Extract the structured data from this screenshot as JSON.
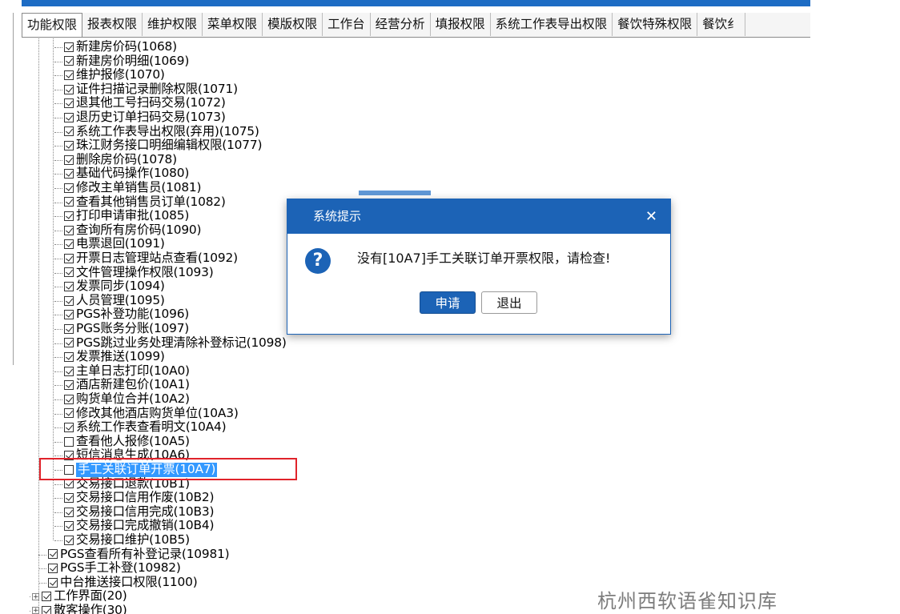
{
  "tabs": [
    {
      "label": "功能权限",
      "active": true
    },
    {
      "label": "报表权限"
    },
    {
      "label": "维护权限"
    },
    {
      "label": "菜单权限"
    },
    {
      "label": "模版权限"
    },
    {
      "label": "工作台"
    },
    {
      "label": "经营分析"
    },
    {
      "label": "填报权限"
    },
    {
      "label": "系统工作表导出权限"
    },
    {
      "label": "餐饮特殊权限"
    },
    {
      "label": "餐饮纟"
    }
  ],
  "tree": {
    "children": [
      {
        "label": "新建房价码(1068)",
        "checked": true
      },
      {
        "label": "新建房价明细(1069)",
        "checked": true
      },
      {
        "label": "维护报修(1070)",
        "checked": true
      },
      {
        "label": "证件扫描记录删除权限(1071)",
        "checked": true
      },
      {
        "label": "退其他工号扫码交易(1072)",
        "checked": true
      },
      {
        "label": "退历史订单扫码交易(1073)",
        "checked": true
      },
      {
        "label": "系统工作表导出权限(弃用)(1075)",
        "checked": true
      },
      {
        "label": "珠江财务接口明细编辑权限(1077)",
        "checked": true
      },
      {
        "label": "删除房价码(1078)",
        "checked": true
      },
      {
        "label": "基础代码操作(1080)",
        "checked": true
      },
      {
        "label": "修改主单销售员(1081)",
        "checked": true
      },
      {
        "label": "查看其他销售员订单(1082)",
        "checked": true
      },
      {
        "label": "打印申请审批(1085)",
        "checked": true
      },
      {
        "label": "查询所有房价码(1090)",
        "checked": true
      },
      {
        "label": "电票退回(1091)",
        "checked": true
      },
      {
        "label": "开票日志管理站点查看(1092)",
        "checked": true
      },
      {
        "label": "文件管理操作权限(1093)",
        "checked": true
      },
      {
        "label": "发票同步(1094)",
        "checked": true
      },
      {
        "label": "人员管理(1095)",
        "checked": true
      },
      {
        "label": "PGS补登功能(1096)",
        "checked": true
      },
      {
        "label": "PGS账务分账(1097)",
        "checked": true
      },
      {
        "label": "PGS跳过业务处理清除补登标记(1098)",
        "checked": true
      },
      {
        "label": "发票推送(1099)",
        "checked": true
      },
      {
        "label": "主单日志打印(10A0)",
        "checked": true
      },
      {
        "label": "酒店新建包价(10A1)",
        "checked": true
      },
      {
        "label": "购货单位合并(10A2)",
        "checked": true
      },
      {
        "label": "修改其他酒店购货单位(10A3)",
        "checked": true
      },
      {
        "label": "系统工作表查看明文(10A4)",
        "checked": true
      },
      {
        "label": "查看他人报修(10A5)",
        "checked": false
      },
      {
        "label": "短信消息生成(10A6)",
        "checked": true
      },
      {
        "label": "手工关联订单开票(10A7)",
        "checked": false,
        "selected": true
      },
      {
        "label": "交易接口退款(10B1)",
        "checked": true
      },
      {
        "label": "交易接口信用作废(10B2)",
        "checked": true
      },
      {
        "label": "交易接口信用完成(10B3)",
        "checked": true
      },
      {
        "label": "交易接口完成撤销(10B4)",
        "checked": true
      },
      {
        "label": "交易接口维护(10B5)",
        "checked": true
      }
    ],
    "siblings": [
      {
        "label": "PGS查看所有补登记录(10981)",
        "checked": true
      },
      {
        "label": "PGS手工补登(10982)",
        "checked": true
      },
      {
        "label": "中台推送接口权限(1100)",
        "checked": true
      },
      {
        "label": "工作界面(20)",
        "checked": true,
        "expander": "+"
      },
      {
        "label": "散客操作(30)",
        "checked": true,
        "expander": "+"
      }
    ]
  },
  "dialog": {
    "title": "系统提示",
    "close_glyph": "✕",
    "icon": "question-icon",
    "icon_glyph": "?",
    "message": "没有[10A7]手工关联订单开票权限，请检查!",
    "apply_label": "申请",
    "exit_label": "退出"
  },
  "watermark": "杭州西软语雀知识库",
  "colors": {
    "accent": "#1c63b6",
    "selection": "#3399ff",
    "highlight_box": "#e0232b"
  }
}
